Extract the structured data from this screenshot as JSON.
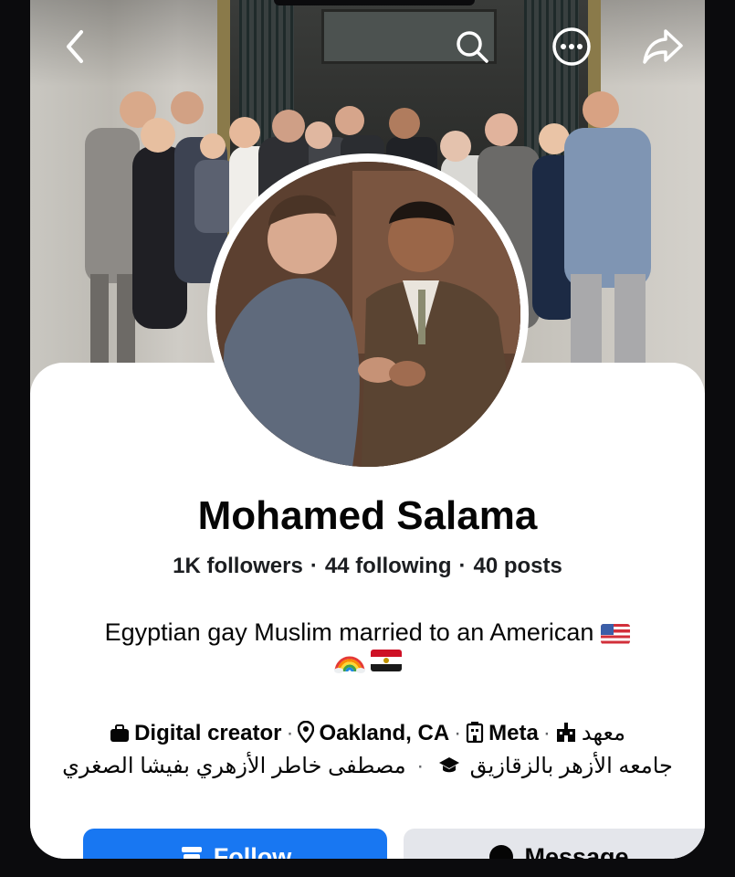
{
  "header": {
    "back_icon": "chevron-left-icon",
    "search_icon": "search-icon",
    "more_icon": "more-horizontal-icon",
    "share_icon": "share-arrow-icon"
  },
  "profile": {
    "name": "Mohamed Salama",
    "stats": {
      "followers": "1K followers",
      "following": "44 following",
      "posts": "40 posts",
      "separator": "·"
    },
    "bio": {
      "text": "Egyptian gay Muslim married to an American",
      "emoji_flags": [
        "us-flag",
        "rainbow",
        "egypt-flag"
      ]
    },
    "details": {
      "category": "Digital creator",
      "location": "Oakland, CA",
      "work": "Meta",
      "school_ar_1": "معهد",
      "school_ar_2": "جامعه الأزهر بالزقازيق",
      "school_ar_3": "مصطفى خاطر الأزهري بفيشا الصغري",
      "separator": "·"
    }
  },
  "actions": {
    "follow_label": "Follow",
    "message_label": "Message"
  },
  "colors": {
    "accent": "#1877f2",
    "secondary_button": "#e4e6eb",
    "text": "#050505"
  }
}
